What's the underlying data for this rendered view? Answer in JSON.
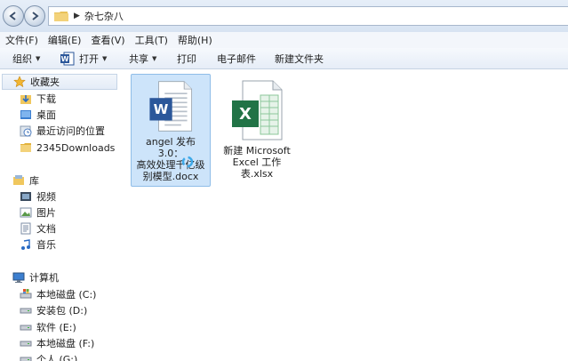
{
  "address": {
    "crumb": "杂七杂八"
  },
  "menu": [
    "文件(F)",
    "编辑(E)",
    "查看(V)",
    "工具(T)",
    "帮助(H)"
  ],
  "toolbar": {
    "organize": "组织",
    "open": "打开",
    "share": "共享",
    "print": "打印",
    "email": "电子邮件",
    "new_folder": "新建文件夹"
  },
  "nav": {
    "favorites": {
      "title": "收藏夹",
      "items": [
        "下载",
        "桌面",
        "最近访问的位置",
        "2345Downloads"
      ]
    },
    "libraries": {
      "title": "库",
      "items": [
        "视频",
        "图片",
        "文档",
        "音乐"
      ]
    },
    "computer": {
      "title": "计算机",
      "items": [
        "本地磁盘 (C:)",
        "安装包 (D:)",
        "软件 (E:)",
        "本地磁盘 (F:)",
        "个人 (G:)"
      ]
    }
  },
  "files": [
    {
      "name_line1": "angel 发布 3.0：",
      "name_line2": "高效处理千亿级",
      "name_line3": "别模型.docx",
      "type": "word-document-icon"
    },
    {
      "name_line1": "新建 Microsoft",
      "name_line2": "Excel 工作表.xlsx",
      "type": "excel-workbook-icon"
    }
  ],
  "colors": {
    "word_blue": "#2b579a",
    "excel_green": "#217346",
    "selection": "#cde4fa"
  }
}
